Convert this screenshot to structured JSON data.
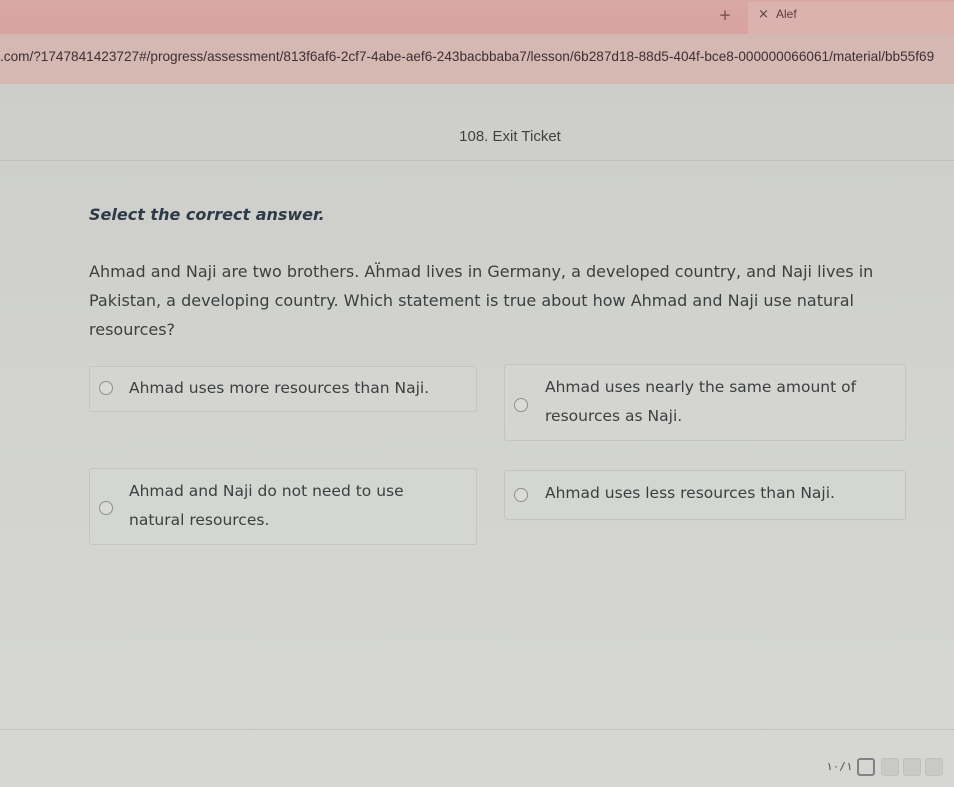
{
  "browser": {
    "new_tab_glyph": "+",
    "tab": {
      "close_glyph": "×",
      "title": "Alef"
    },
    "url": ".com/?1747841423727#/progress/assessment/813f6af6-2cf7-4abe-aef6-243bacbbaba7/lesson/6b287d18-88d5-404f-bce8-000000066061/material/bb55f69"
  },
  "page": {
    "header_title": "108. Exit Ticket",
    "instruction": "Select the correct answer.",
    "question": "Ahmad and Naji are two brothers. Aḧmad lives in Germany, a developed country, and Naji lives in Pakistan, a developing country. Which statement is true about how Ahmad and Naji use natural resources?",
    "options": [
      {
        "label": "Ahmad uses more resources than Naji."
      },
      {
        "label": "Ahmad uses nearly the same amount of resources as Naji."
      },
      {
        "label": "Ahmad and Naji do not need to use natural resources."
      },
      {
        "label": "Ahmad uses less resources than Naji."
      }
    ]
  },
  "footer": {
    "counter": "١٠/١"
  },
  "colors": {
    "tab_strip": "#d8a29f",
    "page_bg": "#d0d1cd",
    "instruction_text": "#2f3a48"
  }
}
